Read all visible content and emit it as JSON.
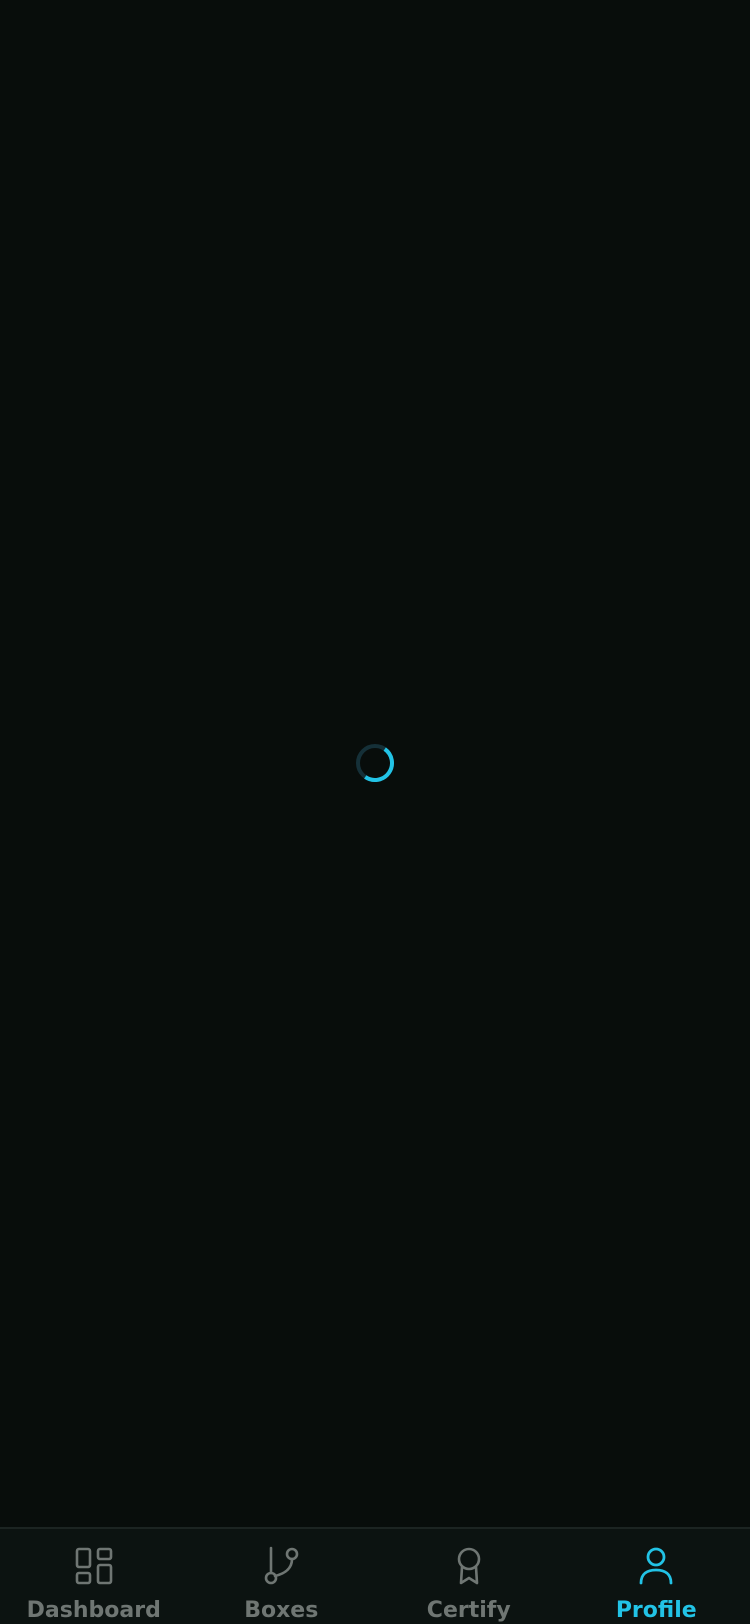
{
  "loading": {
    "indicator_icon": "loading-spinner",
    "track_color": "#153038",
    "accent_color": "#22c3e6"
  },
  "tabbar": {
    "active_color": "#22c3e6",
    "inactive_color": "#6f7673",
    "items": [
      {
        "label": "Dashboard",
        "icon": "dashboard-grid-icon",
        "active": false
      },
      {
        "label": "Boxes",
        "icon": "git-branch-icon",
        "active": false
      },
      {
        "label": "Certify",
        "icon": "award-ribbon-icon",
        "active": false
      },
      {
        "label": "Profile",
        "icon": "user-icon",
        "active": true
      }
    ]
  }
}
